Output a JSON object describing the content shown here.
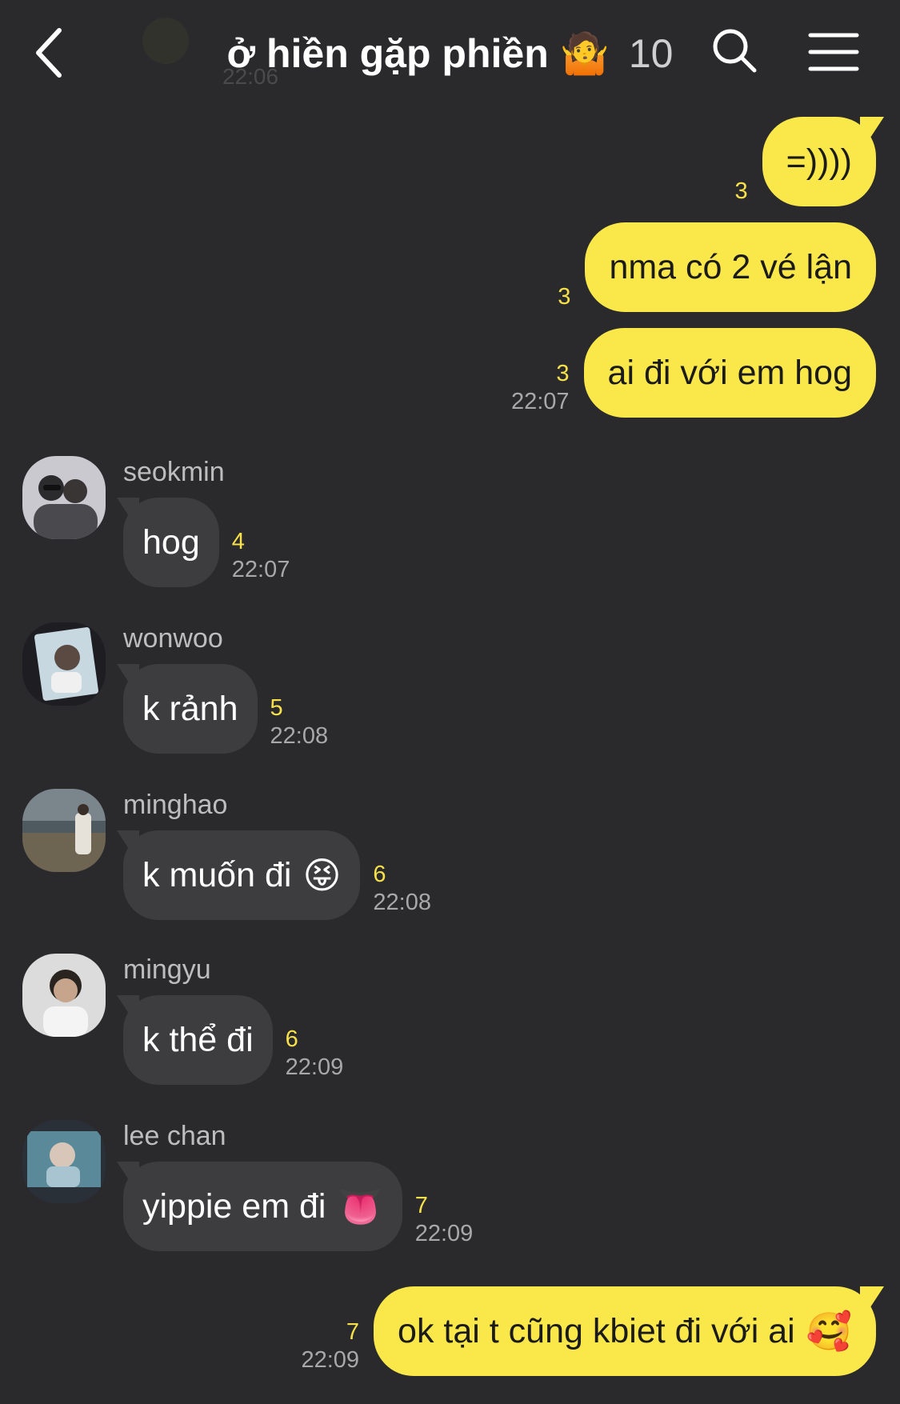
{
  "header": {
    "title": "ở hiền gặp phiền",
    "title_emoji": "🤷",
    "member_count": "10",
    "behind_time": "22:06"
  },
  "icons": {
    "back": "chevron-left-icon",
    "search": "search-icon",
    "menu": "hamburger-menu-icon"
  },
  "colors": {
    "background": "#2a2a2d",
    "outgoing_bubble": "#fae84a",
    "incoming_bubble": "#3d3d40",
    "unread_count": "#f7e04b"
  },
  "messages_outgoing_top": [
    {
      "text": "=))))",
      "unread": "3",
      "time": ""
    },
    {
      "text": "nma có 2 vé lận",
      "unread": "3",
      "time": ""
    },
    {
      "text": "ai đi với em hog",
      "unread": "3",
      "time": "22:07"
    }
  ],
  "messages_incoming": [
    {
      "sender": "seokmin",
      "text": "hog",
      "emoji": "",
      "unread": "4",
      "time": "22:07"
    },
    {
      "sender": "wonwoo",
      "text": "k rảnh",
      "emoji": "",
      "unread": "5",
      "time": "22:08"
    },
    {
      "sender": "minghao",
      "text": "k muốn đi",
      "emoji": "😝",
      "unread": "6",
      "time": "22:08"
    },
    {
      "sender": "mingyu",
      "text": "k thể đi",
      "emoji": "",
      "unread": "6",
      "time": "22:09"
    },
    {
      "sender": "lee chan",
      "text": "yippie em đi",
      "emoji": "👅",
      "unread": "7",
      "time": "22:09"
    }
  ],
  "message_outgoing_last": {
    "text": "ok tại t cũng kbiet đi với ai",
    "emoji": "🥰",
    "unread": "7",
    "time": "22:09"
  }
}
